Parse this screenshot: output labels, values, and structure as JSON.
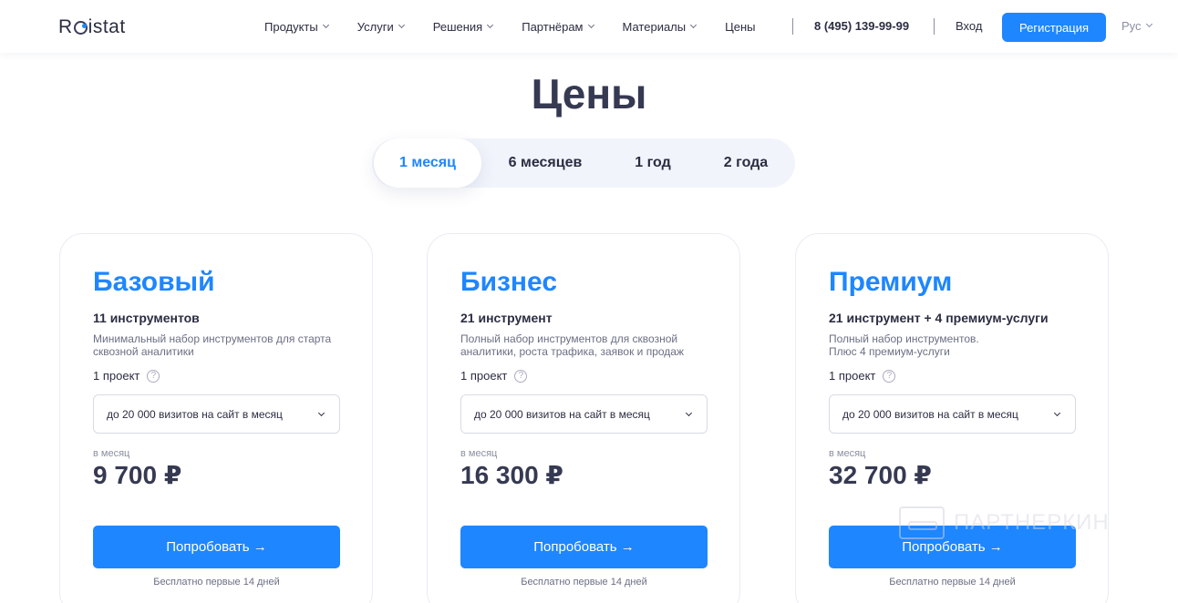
{
  "header": {
    "logo": "Roistat",
    "nav": [
      {
        "label": "Продукты"
      },
      {
        "label": "Услуги"
      },
      {
        "label": "Решения"
      },
      {
        "label": "Партнёрам"
      },
      {
        "label": "Материалы"
      },
      {
        "label": "Цены"
      }
    ],
    "phone": "8 (495) 139-99-99",
    "login": "Вход",
    "register": "Регистрация",
    "lang": "Рус"
  },
  "page_title": "Цены",
  "tabs": [
    "1 месяц",
    "6 месяцев",
    "1 год",
    "2 года"
  ],
  "active_tab": "1 месяц",
  "plans": [
    {
      "name": "Базовый",
      "count": "11 инструментов",
      "desc_line1": "Минимальный набор инструментов для старта",
      "desc_line2": "сквозной аналитики",
      "projects": "1 проект",
      "visits": "до 20 000 визитов на сайт в месяц",
      "per": "в месяц",
      "price": "9 700 ₽",
      "cta": "Попробовать →",
      "note": "Бесплатно первые 14 дней"
    },
    {
      "name": "Бизнес",
      "count": "21 инструмент",
      "desc_line1": "Полный набор инструментов для сквозной",
      "desc_line2": "аналитики, роста трафика, заявок и продаж",
      "projects": "1 проект",
      "visits": "до 20 000 визитов на сайт в месяц",
      "per": "в месяц",
      "price": "16 300 ₽",
      "cta": "Попробовать →",
      "note": "Бесплатно первые 14 дней"
    },
    {
      "name": "Премиум",
      "count": "21 инструмент + 4 премиум-услуги",
      "desc_line1": "Полный набор инструментов.",
      "desc_line2": "Плюс 4 премиум-услуги",
      "projects": "1 проект",
      "visits": "до 20 000 визитов на сайт в месяц",
      "per": "в месяц",
      "price": "32 700 ₽",
      "cta": "Попробовать →",
      "note": "Бесплатно первые 14 дней"
    }
  ],
  "help_glyph": "?",
  "watermark": "ПАРТНЕРКИН",
  "colors": {
    "accent": "#1e86ff",
    "title": "#363952",
    "text": "#2b2d42"
  }
}
